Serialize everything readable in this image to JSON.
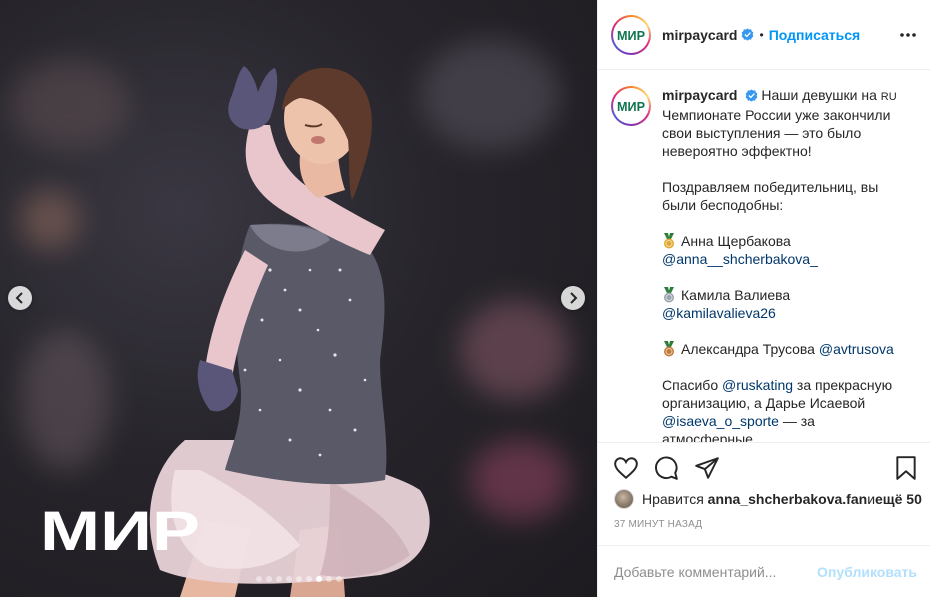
{
  "post": {
    "username": "mirpaycard",
    "follow_label": "Подписаться",
    "separator": "•",
    "logo_text": "МИР"
  },
  "media": {
    "watermark": "МИР",
    "dots_total": 9,
    "dots_active": 7
  },
  "caption": {
    "intro_1": "Наши девушки на ",
    "ru_tag": "RU",
    "intro_2": " Чемпионате России уже закончили свои выступления — это было невероятно эффектно!",
    "congrats": "Поздравляем победительниц, вы были бесподобны:",
    "winners": [
      {
        "medal": "gold-medal",
        "name": "Анна Щербакова",
        "handle": "@anna__shcherbakova_"
      },
      {
        "medal": "silver-medal",
        "name": "Камила Валиева",
        "handle": "@kamilavalieva26"
      },
      {
        "medal": "bronze-medal",
        "name": "Александра Трусова",
        "handle": "@avtrusova"
      }
    ],
    "thanks_1": "Спасибо ",
    "thanks_mention_1": "@ruskating",
    "thanks_2": " за прекрасную организацию, а Дарье Исаевой ",
    "thanks_mention_2": "@isaeva_o_sporte",
    "thanks_3": " — за атмосферные"
  },
  "likes": {
    "prefix": "Нравится ",
    "user": "anna_shcherbakova.fan",
    "middle": " и ",
    "rest": "ещё 50"
  },
  "timestamp": "37 МИНУТ НАЗАД",
  "comment": {
    "placeholder": "Добавьте комментарий...",
    "publish_label": "Опубликовать"
  },
  "colors": {
    "accent": "#0095f6",
    "mention": "#00376b",
    "publish_disabled": "#b2dffc",
    "mir_green": "#0f754e",
    "mir_blue": "#00b4e6"
  }
}
